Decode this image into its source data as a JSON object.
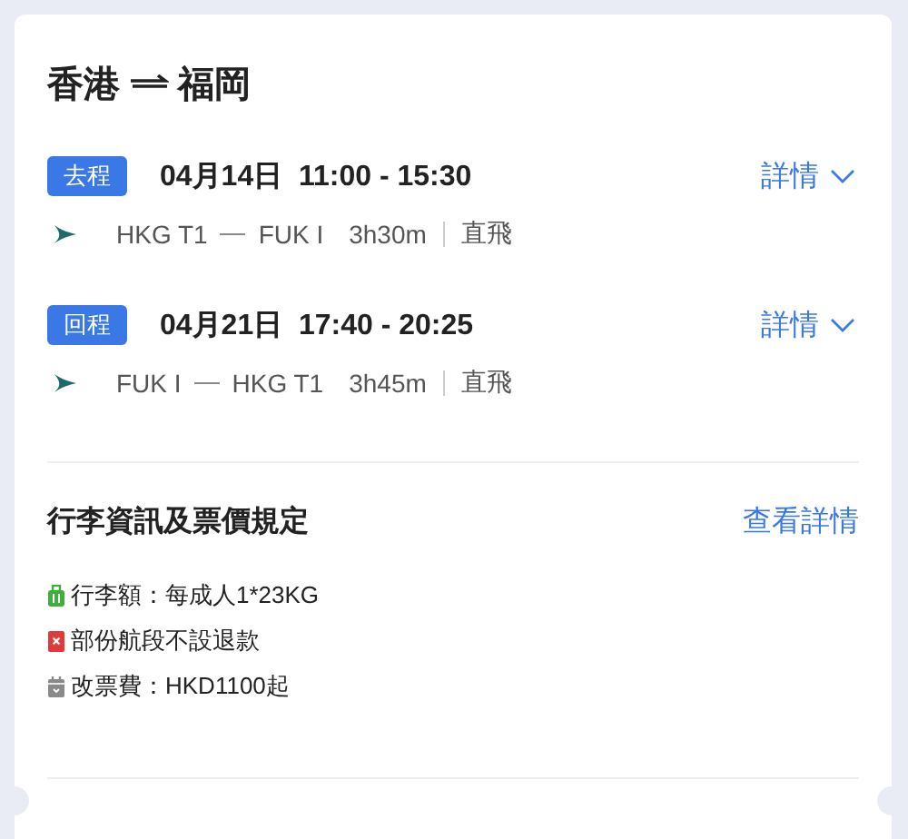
{
  "title": {
    "from": "香港",
    "to": "福岡"
  },
  "segments": [
    {
      "tag": "去程",
      "datetime": "04月14日  11:00 - 15:30",
      "details": "詳情",
      "origin": "HKG T1",
      "destination": "FUK I",
      "duration": "3h30m",
      "stops": "直飛"
    },
    {
      "tag": "回程",
      "datetime": "04月21日  17:40 - 20:25",
      "details": "詳情",
      "origin": "FUK I",
      "destination": "HKG T1",
      "duration": "3h45m",
      "stops": "直飛"
    }
  ],
  "rules": {
    "title": "行李資訊及票價規定",
    "link": "查看詳情",
    "items": [
      {
        "kind": "baggage",
        "text": "行李額：每成人1*23KG"
      },
      {
        "kind": "refund",
        "text": "部份航段不設退款"
      },
      {
        "kind": "change",
        "text": "改票費：HKD1100起"
      }
    ]
  }
}
